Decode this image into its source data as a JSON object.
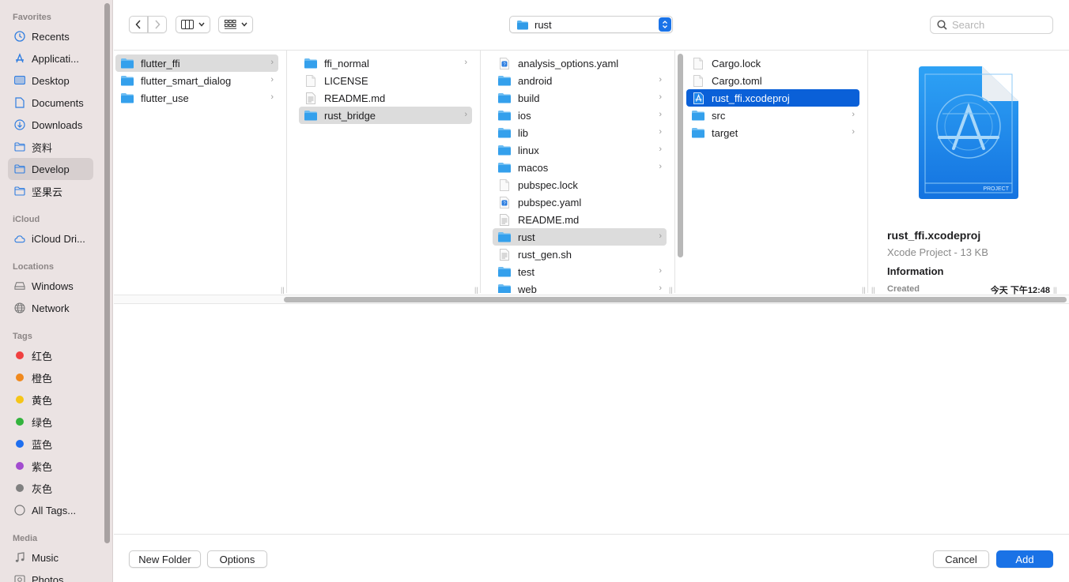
{
  "sidebar": {
    "sections": [
      {
        "title": "Favorites"
      },
      {
        "title": "iCloud"
      },
      {
        "title": "Locations"
      },
      {
        "title": "Tags"
      },
      {
        "title": "Media"
      }
    ],
    "favorites": [
      {
        "label": "Recents",
        "icon": "clock-icon"
      },
      {
        "label": "Applicati...",
        "icon": "applications-icon"
      },
      {
        "label": "Desktop",
        "icon": "desktop-icon"
      },
      {
        "label": "Documents",
        "icon": "document-icon"
      },
      {
        "label": "Downloads",
        "icon": "download-icon"
      },
      {
        "label": "资料",
        "icon": "folder-icon"
      },
      {
        "label": "Develop",
        "icon": "folder-icon",
        "selected": true
      },
      {
        "label": "坚果云",
        "icon": "folder-icon"
      }
    ],
    "icloud": [
      {
        "label": "iCloud Dri...",
        "icon": "cloud-icon"
      }
    ],
    "locations": [
      {
        "label": "Windows",
        "icon": "drive-icon"
      },
      {
        "label": "Network",
        "icon": "globe-icon"
      }
    ],
    "tags": [
      {
        "label": "红色",
        "color": "#f04040"
      },
      {
        "label": "橙色",
        "color": "#f0891d"
      },
      {
        "label": "黄色",
        "color": "#f5c518"
      },
      {
        "label": "绿色",
        "color": "#33b33d"
      },
      {
        "label": "蓝色",
        "color": "#1e6ff0"
      },
      {
        "label": "紫色",
        "color": "#a24ccf"
      },
      {
        "label": "灰色",
        "color": "#808080"
      },
      {
        "label": "All Tags...",
        "icon": "tags-icon"
      }
    ],
    "media": [
      {
        "label": "Music",
        "icon": "music-icon"
      },
      {
        "label": "Photos",
        "icon": "photos-icon"
      }
    ]
  },
  "toolbar": {
    "path_label": "rust",
    "search_placeholder": "Search"
  },
  "columns": [
    {
      "items": [
        {
          "name": "flutter_ffi",
          "type": "folder",
          "state": "gray",
          "chevron": true
        },
        {
          "name": "flutter_smart_dialog",
          "type": "folder",
          "chevron": true
        },
        {
          "name": "flutter_use",
          "type": "folder",
          "chevron": true
        }
      ]
    },
    {
      "items": [
        {
          "name": "ffi_normal",
          "type": "folder",
          "chevron": true
        },
        {
          "name": "LICENSE",
          "type": "file"
        },
        {
          "name": "README.md",
          "type": "text"
        },
        {
          "name": "rust_bridge",
          "type": "folder",
          "state": "gray",
          "chevron": true
        }
      ]
    },
    {
      "items": [
        {
          "name": "analysis_options.yaml",
          "type": "yaml"
        },
        {
          "name": "android",
          "type": "folder",
          "chevron": true
        },
        {
          "name": "build",
          "type": "folder",
          "chevron": true
        },
        {
          "name": "ios",
          "type": "folder",
          "chevron": true
        },
        {
          "name": "lib",
          "type": "folder",
          "chevron": true
        },
        {
          "name": "linux",
          "type": "folder",
          "chevron": true
        },
        {
          "name": "macos",
          "type": "folder",
          "chevron": true
        },
        {
          "name": "pubspec.lock",
          "type": "file"
        },
        {
          "name": "pubspec.yaml",
          "type": "yaml"
        },
        {
          "name": "README.md",
          "type": "text"
        },
        {
          "name": "rust",
          "type": "folder",
          "state": "gray",
          "chevron": true
        },
        {
          "name": "rust_gen.sh",
          "type": "text"
        },
        {
          "name": "test",
          "type": "folder",
          "chevron": true
        },
        {
          "name": "web",
          "type": "folder",
          "chevron": true
        }
      ]
    },
    {
      "items": [
        {
          "name": "Cargo.lock",
          "type": "file"
        },
        {
          "name": "Cargo.toml",
          "type": "file"
        },
        {
          "name": "rust_ffi.xcodeproj",
          "type": "xcode",
          "state": "blue"
        },
        {
          "name": "src",
          "type": "folder",
          "chevron": true
        },
        {
          "name": "target",
          "type": "folder",
          "chevron": true
        }
      ]
    }
  ],
  "preview": {
    "name": "rust_ffi.xcodeproj",
    "kind": "Xcode Project - 13 KB",
    "info_heading": "Information",
    "created_label": "Created",
    "created_value": "今天 下午12:48",
    "badge": "PROJECT"
  },
  "footer": {
    "new_folder": "New Folder",
    "options": "Options",
    "cancel": "Cancel",
    "add": "Add"
  }
}
